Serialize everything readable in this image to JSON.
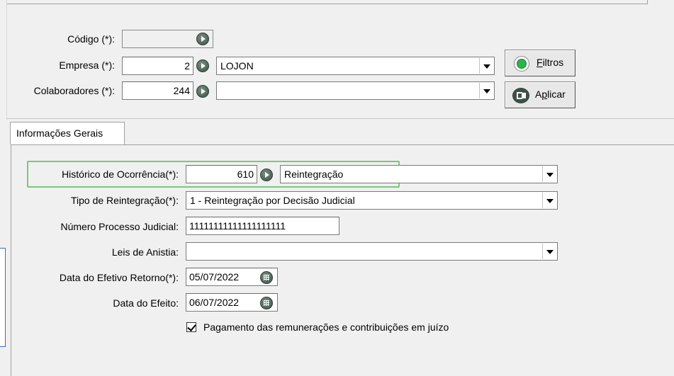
{
  "header": {
    "codigo_label": "Código (*):",
    "empresa_label": "Empresa (*):",
    "empresa_code": "2",
    "empresa_name": "LOJON",
    "colaboradores_label": "Colaboradores (*):",
    "colaboradores_code": "244",
    "colaboradores_name": "",
    "filtros_label_first": "F",
    "filtros_label_rest": "iltros",
    "aplicar_label_first": "A",
    "aplicar_label_mid": "p",
    "aplicar_label_rest": "licar"
  },
  "tabs": [
    {
      "label": "Informações Gerais"
    }
  ],
  "form": {
    "historico_label": "Histórico de Ocorrência(*):",
    "historico_code": "610",
    "historico_name": "Reintegração",
    "tipo_label": "Tipo de Reintegração(*):",
    "tipo_value": "1 - Reintegração por Decisão Judicial",
    "processo_label": "Número Processo Judicial:",
    "processo_value": "11111111111111111111",
    "leis_label": "Leis de Anistia:",
    "leis_value": "",
    "retorno_label": "Data do Efetivo Retorno(*):",
    "retorno_value": "05/07/2022",
    "efeito_label": "Data do Efeito:",
    "efeito_value": "06/07/2022",
    "pagamento_label": "Pagamento das remunerações e contribuições em juízo",
    "pagamento_checked": true
  },
  "colors": {
    "highlight": "#79c97a",
    "icon": "#3d5247",
    "filtros_icon": "#2db34a"
  }
}
